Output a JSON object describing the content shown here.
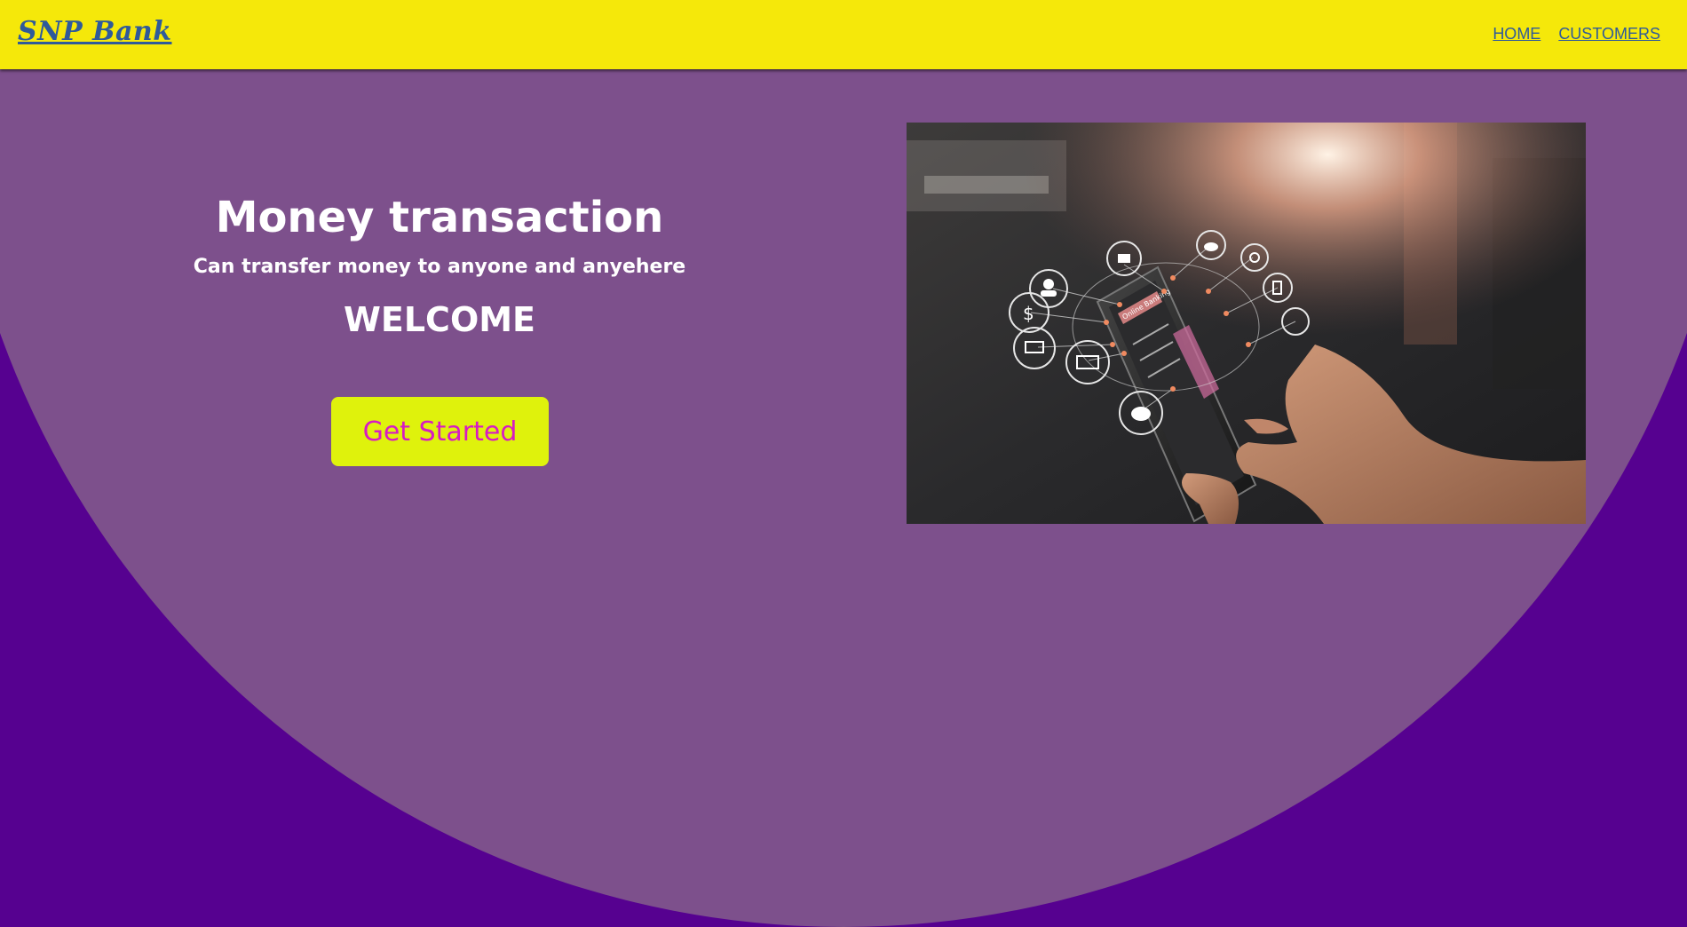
{
  "navbar": {
    "brand": "SNP Bank",
    "links": [
      "HOME",
      "CUSTOMERS"
    ]
  },
  "hero": {
    "title": "Money transaction",
    "subtitle": "Can transfer money to anyone and anyehere",
    "welcome": "WELCOME",
    "cta_label": "Get Started",
    "image_screen_text": "Online Banking"
  },
  "colors": {
    "navbar_bg": "#f5e80a",
    "brand_text": "#2f5a9a",
    "page_bg": "#560190",
    "hero_circle": "#7d508c",
    "cta_bg": "#dff20c",
    "cta_text": "#d71bc4"
  },
  "icons": [
    "bank-icon",
    "person-icon",
    "dollar-icon",
    "laptop-icon",
    "card-icon",
    "piggy-bank-icon",
    "cloud-icon",
    "lock-icon",
    "phone-icon"
  ]
}
